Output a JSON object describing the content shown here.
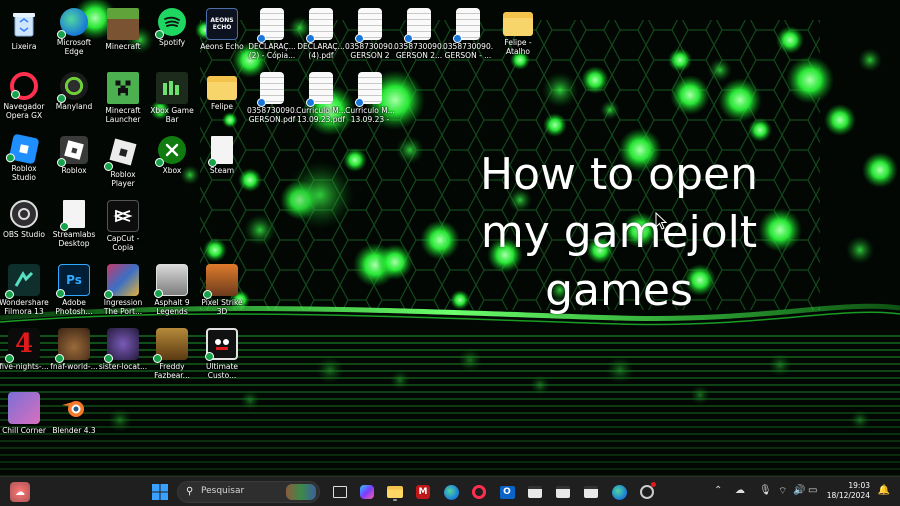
{
  "headline": {
    "line1": "How to open",
    "line2": "my gamejolt",
    "line3": "games"
  },
  "desktop_icons": {
    "lixeira": "Lixeira",
    "edge": "Microsoft Edge",
    "minecraft": "Minecraft",
    "spotify": "Spotify",
    "aeons_echo": "Aeons Echo",
    "aeons_logo_text": "AEONS ECHO",
    "doc1": "DECLARAÇ... (2) - Cópia...",
    "doc2": "DECLARAÇ... (4).pdf",
    "doc3": "0358730090... GERSON 2 -...",
    "doc4": "0358730090... GERSON 2...",
    "doc5": "0358730090... GERSON - ...",
    "felipe_atalho": "Felipe - Atalho",
    "opera_gx": "Navegador Opera GX",
    "manyland": "Manyland",
    "mc_launcher": "Minecraft Launcher",
    "xbox_game_bar": "Xbox Game Bar",
    "felipe": "Felipe",
    "doc6": "0358730090... GERSON.pdf",
    "doc7": "Curriculo M... 13.09.23.pdf",
    "doc8": "Curriculo M... 13.09.23 - C...",
    "roblox_studio": "Roblox Studio",
    "roblox": "Roblox",
    "roblox_player": "Roblox Player",
    "xbox": "Xbox",
    "steam": "Steam",
    "obs": "OBS Studio",
    "streamlabs": "Streamlabs Desktop",
    "capcut": "CapCut - Copia",
    "filmora": "Wondershare Filmora 13",
    "photoshop": "Adobe Photosh...",
    "ingression": "Ingression The Port...",
    "asphalt": "Asphalt 9 Legends",
    "pixel_strike": "Pixel Strike 3D",
    "fnaf4": "five-nights-...",
    "fnaf_world": "fnaf-world-...",
    "sister_location": "sister-locat...",
    "freddy_fazbear": "Freddy Fazbear...",
    "ultimate_custom": "Ultimate Custo...",
    "chill_corner": "Chill Corner",
    "blender": "Blender 4.3"
  },
  "taskbar": {
    "search_placeholder": "Pesquisar",
    "clock_time": "19:03",
    "clock_date": "18/12/2024"
  },
  "colors": {
    "wallpaper_green": "#2bff3a",
    "taskbar_bg": "#1f1f1f",
    "windows_blue": "#3aa0ff"
  },
  "icons": [
    "recycle-bin-icon",
    "edge-icon",
    "minecraft-icon",
    "spotify-icon",
    "pdf-document-icon",
    "folder-icon",
    "opera-gx-icon",
    "roblox-icon",
    "xbox-icon",
    "obs-icon",
    "capcut-icon",
    "photoshop-icon",
    "blender-icon",
    "windows-start-icon",
    "search-icon",
    "wifi-icon",
    "volume-icon",
    "battery-icon",
    "bell-icon"
  ]
}
